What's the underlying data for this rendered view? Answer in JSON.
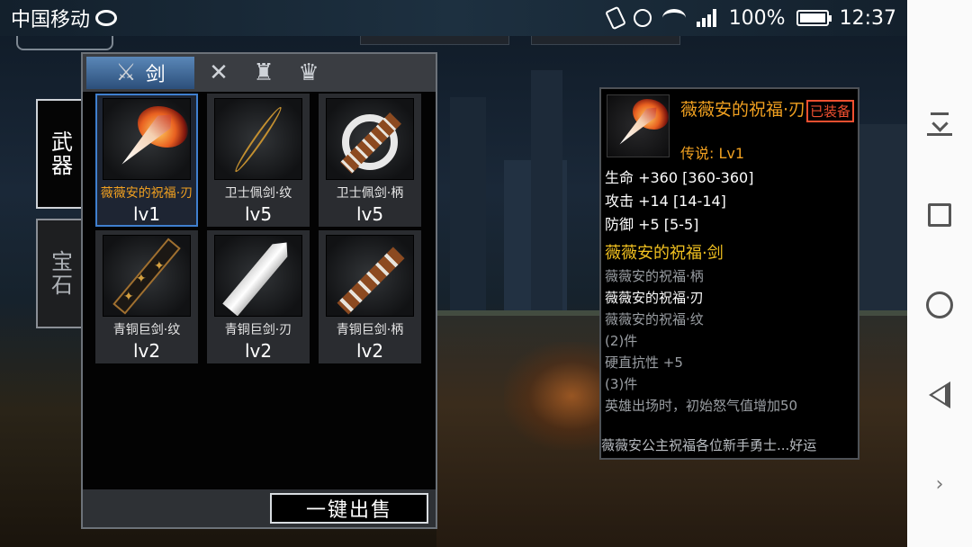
{
  "status_bar": {
    "carrier": "中国移动",
    "battery": "100%",
    "time": "12:37",
    "icons": [
      "weibo-icon",
      "vibrate-icon",
      "alarm-icon",
      "wifi-icon",
      "signal-icon",
      "battery-icon"
    ]
  },
  "side_tabs": [
    {
      "label": "武器",
      "active": true
    },
    {
      "label": "宝石",
      "active": false
    }
  ],
  "inventory": {
    "tabs": [
      {
        "label": "剑",
        "icon": "sword-icon",
        "active": true
      },
      {
        "label": "",
        "icon": "crossed-swords-icon",
        "active": false
      },
      {
        "label": "",
        "icon": "armor-icon",
        "active": false
      },
      {
        "label": "",
        "icon": "helmet-icon",
        "active": false
      }
    ],
    "items": [
      {
        "name": "薇薇安的祝福·刃",
        "level": "lv1",
        "icon": "fire-blade-icon",
        "selected": true
      },
      {
        "name": "卫士佩剑·纹",
        "level": "lv5",
        "icon": "engraved-blade-icon",
        "selected": false
      },
      {
        "name": "卫士佩剑·柄",
        "level": "lv5",
        "icon": "hilt-ring-icon",
        "selected": false
      },
      {
        "name": "青铜巨剑·纹",
        "level": "lv2",
        "icon": "bronze-engraving-icon",
        "selected": false
      },
      {
        "name": "青铜巨剑·刃",
        "level": "lv2",
        "icon": "bronze-blade-icon",
        "selected": false
      },
      {
        "name": "青铜巨剑·柄",
        "level": "lv2",
        "icon": "bronze-hilt-icon",
        "selected": false
      }
    ],
    "sell_all_label": "一键出售"
  },
  "detail": {
    "name": "薇薇安的祝福·刃",
    "equipped_label": "已装备",
    "grade": "传说: Lv1",
    "stats": [
      "生命 +360 [360-360]",
      "攻击 +14 [14-14]",
      "防御 +5 [5-5]"
    ],
    "set_title": "薇薇安的祝福·剑",
    "set_lines": [
      {
        "text": "薇薇安的祝福·柄",
        "active": false
      },
      {
        "text": "薇薇安的祝福·刃",
        "active": true
      },
      {
        "text": "薇薇安的祝福·纹",
        "active": false
      },
      {
        "text": "(2)件",
        "active": false
      },
      {
        "text": "硬直抗性 +5",
        "active": false
      },
      {
        "text": "(3)件",
        "active": false
      },
      {
        "text": "英雄出场时，初始怒气值增加50",
        "active": false
      }
    ],
    "description": "薇薇安公主祝福各位新手勇士...好运"
  },
  "colors": {
    "legendary": "#f0a020",
    "set_title": "#f0c020",
    "equipped": "#f05030",
    "selected_border": "#3f7fcf"
  }
}
